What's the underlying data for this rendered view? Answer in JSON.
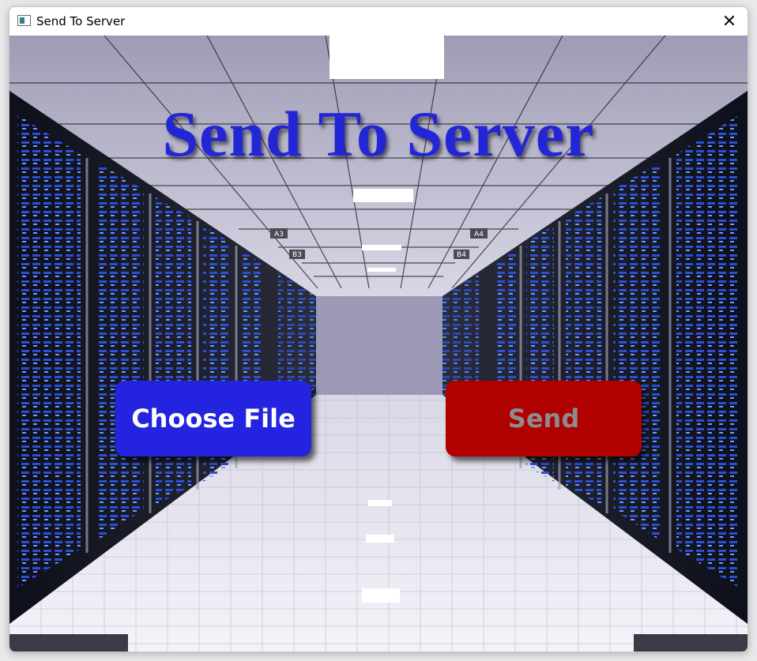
{
  "window": {
    "title": "Send To Server",
    "close_glyph": "✕"
  },
  "main": {
    "heading": "Send To Server",
    "heading_color": "#2326d6",
    "background": "server-room-photo"
  },
  "buttons": {
    "choose_label": "Choose File",
    "choose_color": "#2424e0",
    "send_label": "Send",
    "send_color": "#b00000"
  },
  "signs": [
    "A3",
    "A4",
    "B3",
    "B4"
  ]
}
